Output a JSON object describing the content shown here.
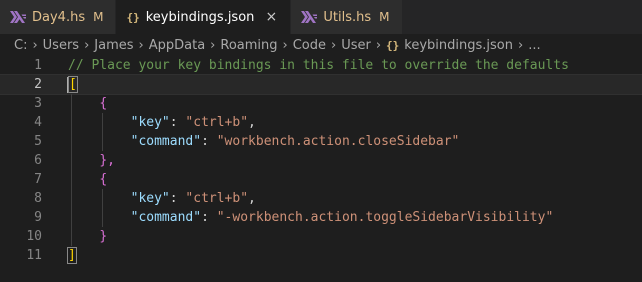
{
  "tabs": [
    {
      "label": "Day4.hs",
      "badge": "M",
      "icon": "haskell-icon",
      "active": false
    },
    {
      "label": "keybindings.json",
      "icon": "json-braces-icon",
      "close": "×",
      "active": true
    },
    {
      "label": "Utils.hs",
      "badge": "M",
      "icon": "haskell-icon",
      "active": false
    }
  ],
  "breadcrumb": {
    "parts": [
      "C:",
      "Users",
      "James",
      "AppData",
      "Roaming",
      "Code",
      "User"
    ],
    "file_icon": "{}",
    "file": "keybindings.json",
    "more": "...",
    "separator": "›"
  },
  "editor": {
    "line_numbers": [
      "1",
      "2",
      "3",
      "4",
      "5",
      "6",
      "7",
      "8",
      "9",
      "10",
      "11"
    ],
    "comment": "// Place your key bindings in this file to override the defaults",
    "open_bracket": "[",
    "close_bracket": "]",
    "open_brace": "{",
    "close_brace": "}",
    "close_brace_comma": "},",
    "bindings": [
      {
        "key_name": "\"key\"",
        "key_value": "\"ctrl+b\"",
        "command_name": "\"command\"",
        "command_value": "\"workbench.action.closeSidebar\""
      },
      {
        "key_name": "\"key\"",
        "key_value": "\"ctrl+b\"",
        "command_name": "\"command\"",
        "command_value": "\"-workbench.action.toggleSidebarVisibility\""
      }
    ]
  },
  "colors": {
    "background": "#1e1e1e",
    "comment": "#6a9955",
    "string": "#ce9178",
    "property": "#9cdcfe",
    "bracket": "#ffd700",
    "brace": "#da70d6",
    "modified": "#e2c08d"
  }
}
